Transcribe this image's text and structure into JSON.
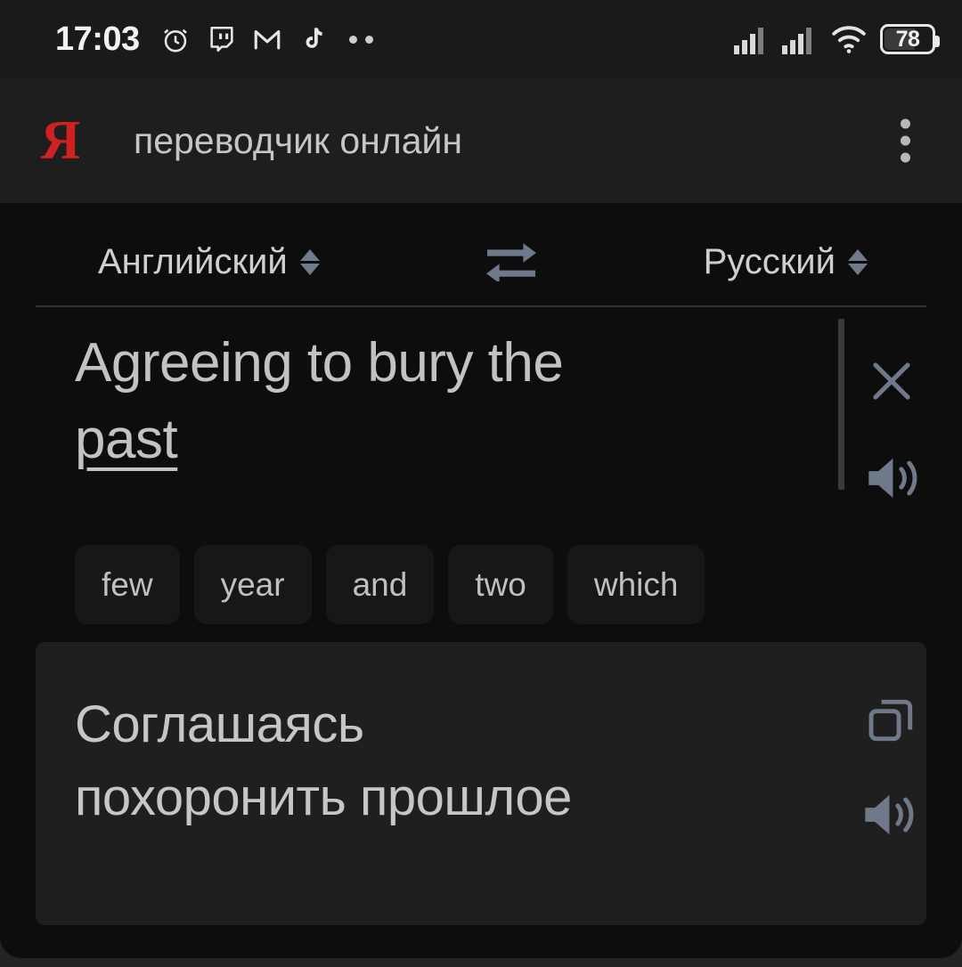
{
  "status_bar": {
    "time": "17:03",
    "icons": [
      "alarm-clock-icon",
      "twitch-icon",
      "gmail-icon",
      "tiktok-icon",
      "more-notifications-icon"
    ],
    "signal_1": "signal-bars-icon",
    "signal_2": "signal-bars-icon",
    "wifi": "wifi-icon",
    "battery_level": "78"
  },
  "app_bar": {
    "logo": "yandex-logo",
    "logo_text": "Я",
    "query": "переводчик онлайн",
    "menu": "overflow-menu-icon"
  },
  "translator": {
    "source_language": "Английский",
    "target_language": "Русский",
    "swap_icon": "swap-languages-icon",
    "source_text_line1": "Agreeing to bury the",
    "source_text_line2": "past",
    "clear_icon": "close-icon",
    "listen_source_icon": "speaker-icon",
    "suggestions": [
      "few",
      "year",
      "and",
      "two",
      "which"
    ],
    "result_text_line1": "Соглашаясь",
    "result_text_line2": "похоронить прошлое",
    "copy_icon": "copy-icon",
    "listen_result_icon": "speaker-icon"
  },
  "colors": {
    "accent_red": "#cc2222",
    "icon_gray": "#717a8a",
    "text_gray": "#c6c6c6",
    "page_bg": "#0d0d0d",
    "result_bg": "#1f1f1f"
  }
}
